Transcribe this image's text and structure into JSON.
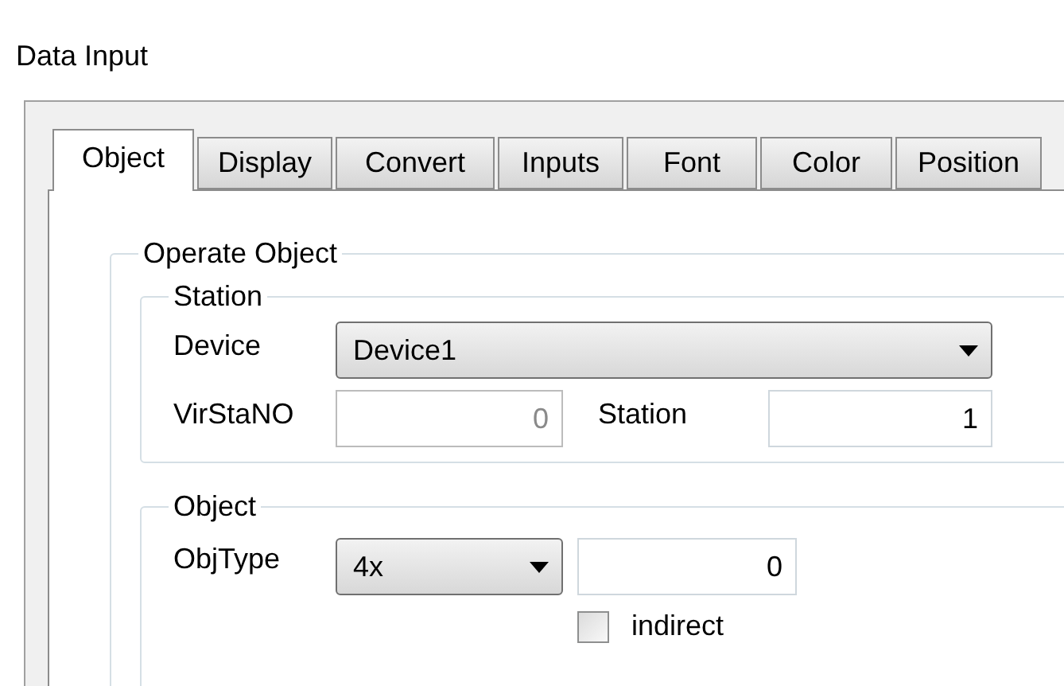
{
  "window": {
    "title": "Data Input"
  },
  "tabs": [
    {
      "label": "Object",
      "selected": true
    },
    {
      "label": "Display",
      "selected": false
    },
    {
      "label": "Convert",
      "selected": false
    },
    {
      "label": "Inputs",
      "selected": false
    },
    {
      "label": "Font",
      "selected": false
    },
    {
      "label": "Color",
      "selected": false
    },
    {
      "label": "Position",
      "selected": false
    }
  ],
  "operate_object": {
    "title": "Operate Object",
    "station": {
      "title": "Station",
      "device": {
        "label": "Device",
        "value": "Device1"
      },
      "virstano": {
        "label": "VirStaNO",
        "value": "0",
        "disabled": true
      },
      "station_no": {
        "label": "Station",
        "value": "1",
        "disabled": false
      }
    },
    "object": {
      "title": "Object",
      "objtype": {
        "label": "ObjType",
        "value": "4x"
      },
      "address": {
        "value": "0",
        "disabled": false
      },
      "indirect": {
        "label": "indirect",
        "checked": false
      }
    }
  }
}
